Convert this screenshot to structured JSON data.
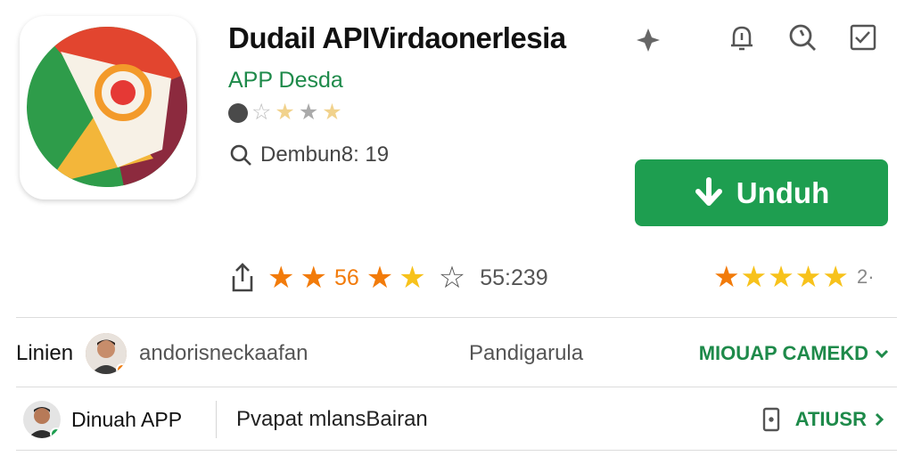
{
  "app": {
    "title": "Dudail APIVirdaonerlesia",
    "developer": "APP Desda",
    "version_text": "Dembun8: 19",
    "install_label": "Unduh",
    "icon": "chrome-like-app-icon"
  },
  "toolbar": {
    "icons": [
      "pin-icon",
      "notification-icon",
      "search-icon",
      "checklist-icon"
    ]
  },
  "stats": {
    "rating_value": "56",
    "review_count": "55:239",
    "extra": "2·"
  },
  "rows": [
    {
      "label": "Linien",
      "username": "andorisneckaafan",
      "middle": "Pandigarula",
      "action": "MIOUAP CAMEKD"
    },
    {
      "label": "Dinuah APP",
      "middle": "Pvapat mlansBairan",
      "action": "ATIUSR"
    }
  ],
  "colors": {
    "accent_green": "#1e9e50",
    "link_green": "#1e8a4a",
    "star_orange": "#f27b0a",
    "star_yellow": "#f7c21b"
  }
}
